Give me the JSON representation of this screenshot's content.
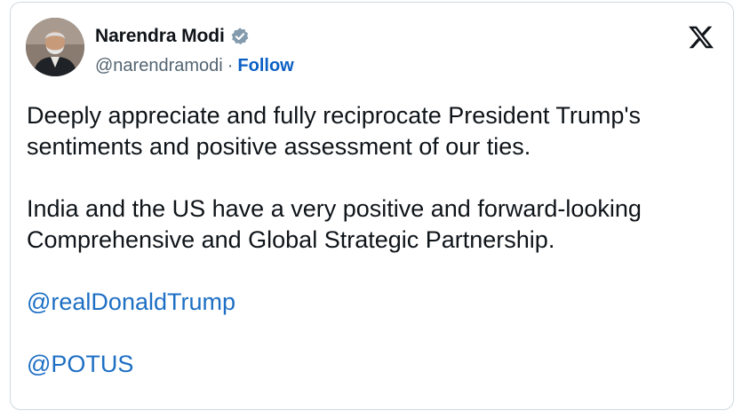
{
  "author": {
    "display_name": "Narendra Modi",
    "handle": "@narendramodi",
    "separator": "·",
    "follow_label": "Follow",
    "verified": true
  },
  "icons": {
    "brand": "x-logo-icon",
    "badge": "verified-badge-icon"
  },
  "tweet": {
    "paragraph_1": "Deeply appreciate and fully reciprocate President Trump's sentiments and positive assessment of our ties.",
    "paragraph_2": "India and the US have a very positive and forward-looking Comprehensive and Global Strategic Partnership.",
    "mentions": [
      "@realDonaldTrump",
      "@POTUS"
    ]
  },
  "colors": {
    "text": "#0f1419",
    "secondary": "#536471",
    "link": "#1d6fc4",
    "follow": "#0b5fc4",
    "border": "#cfd9de",
    "badge": "#829aab"
  }
}
